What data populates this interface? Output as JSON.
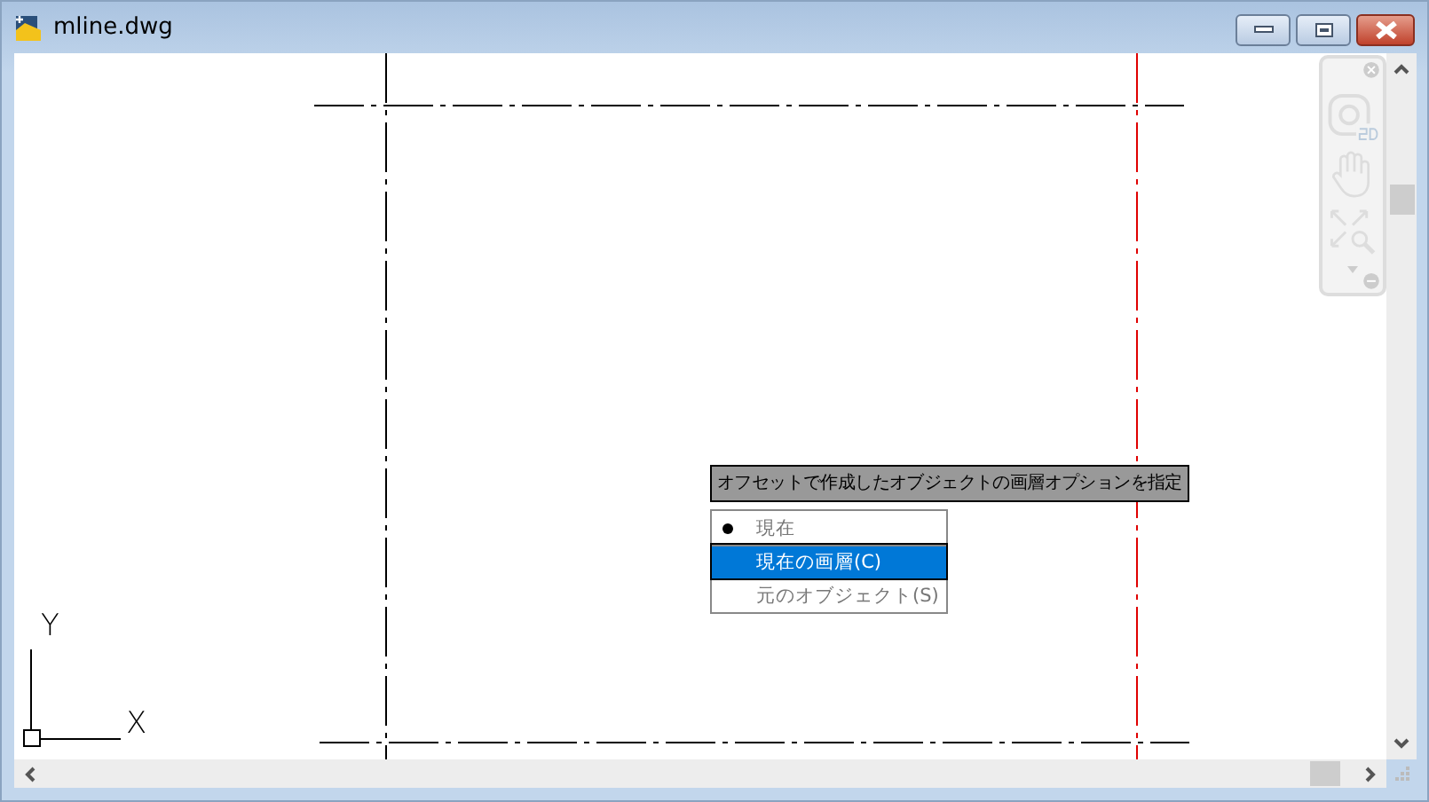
{
  "window": {
    "title": "mline.dwg"
  },
  "tooltip": {
    "text": "オフセットで作成したオブジェクトの画層オプションを指定"
  },
  "menu": {
    "items": [
      {
        "label": "現在",
        "checked": true,
        "selected": false,
        "disabled": true
      },
      {
        "label": "現在の画層(C)",
        "checked": false,
        "selected": true,
        "disabled": false
      },
      {
        "label": "元のオブジェクト(S)",
        "checked": false,
        "selected": false,
        "disabled": true
      }
    ]
  },
  "ucs_icon": {
    "x_label": "X",
    "y_label": "Y"
  }
}
